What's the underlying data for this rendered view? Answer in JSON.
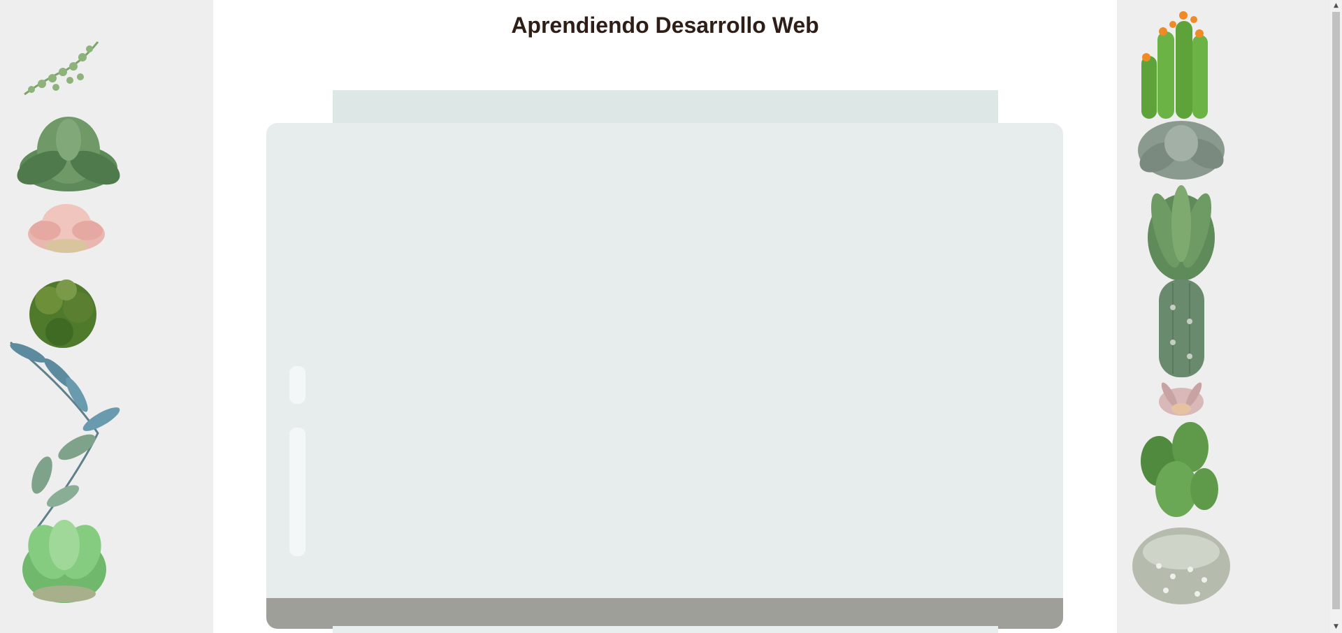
{
  "header": {
    "title": "Aprendiendo Desarrollo Web"
  },
  "colors": {
    "side_panel": "#eeeeee",
    "jar_glass": "#e6edec",
    "jar_lid": "#dde8e6",
    "soil": "#9f9f9a",
    "title_text": "#2e1e18"
  },
  "scrollbar": {
    "up_icon": "▲",
    "down_icon": "▼"
  }
}
